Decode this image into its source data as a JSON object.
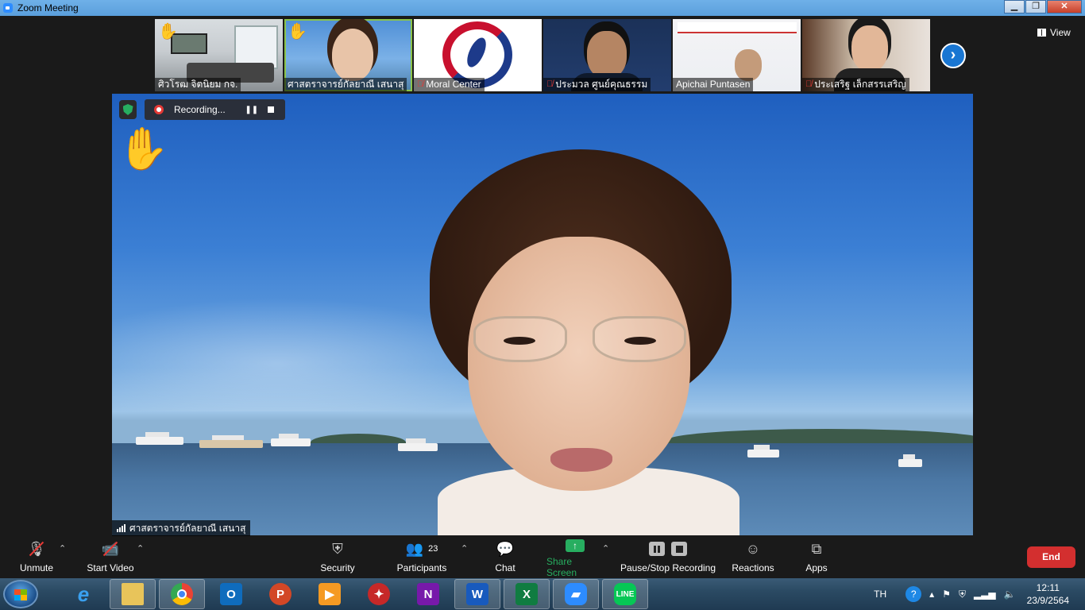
{
  "window": {
    "title": "Zoom Meeting"
  },
  "thumbnails": [
    {
      "name": "ศิวโรฒ จิตนิยม กจ.",
      "muted": false,
      "hand": true
    },
    {
      "name": "ศาสตราจารย์กัลยาณี เสนาสุ",
      "muted": false,
      "hand": true
    },
    {
      "name": "Moral Center",
      "muted": true,
      "hand": false
    },
    {
      "name": "ประมวล ศูนย์คุณธรรม",
      "muted": true,
      "hand": false
    },
    {
      "name": "Apichai Puntasen",
      "muted": false,
      "hand": false
    },
    {
      "name": "ประเสริฐ เล็กสรรเสริญ",
      "muted": true,
      "hand": false
    }
  ],
  "view_label": "View",
  "recording": {
    "label": "Recording..."
  },
  "speaker": {
    "name": "ศาสตราจารย์กัลยาณี เสนาสุ"
  },
  "toolbar": {
    "unmute": "Unmute",
    "start_video": "Start Video",
    "security": "Security",
    "participants": "Participants",
    "participants_count": "23",
    "chat": "Chat",
    "share_screen": "Share Screen",
    "recording_ctrl": "Pause/Stop Recording",
    "reactions": "Reactions",
    "apps": "Apps",
    "end": "End"
  },
  "taskbar": {
    "apps": [
      "internet-explorer",
      "file-explorer",
      "chrome",
      "outlook",
      "powerpoint",
      "media-player",
      "game-app",
      "onenote",
      "word",
      "excel",
      "zoom",
      "line"
    ],
    "language": "TH",
    "time": "12:11",
    "date": "23/9/2564"
  },
  "colors": {
    "share_green": "#27ae60",
    "end_red": "#d32f2f",
    "accent_blue": "#1976d2"
  }
}
